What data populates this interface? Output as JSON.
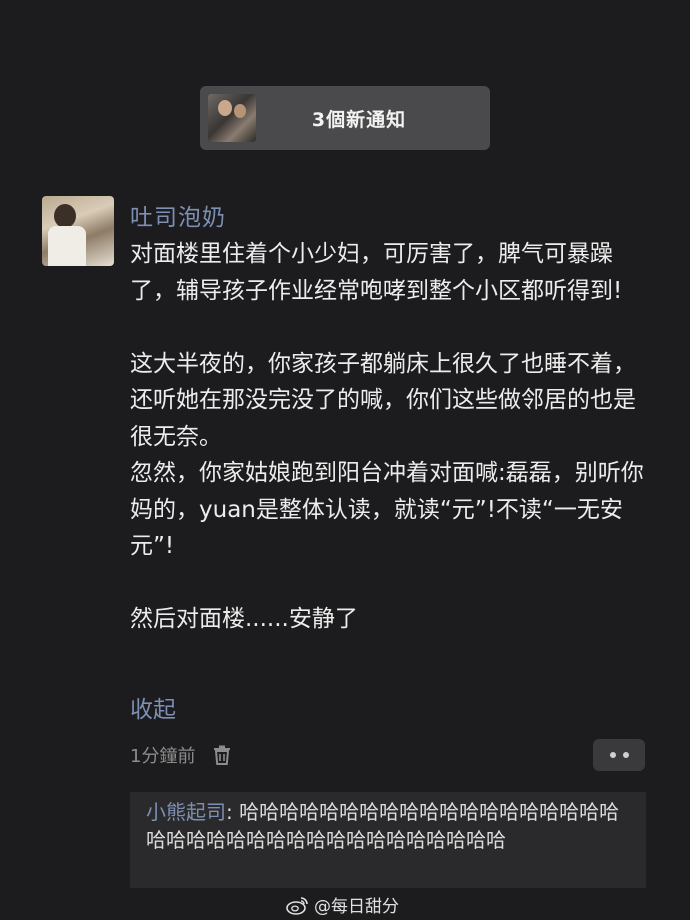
{
  "notification": {
    "text": "3個新通知"
  },
  "post": {
    "username": "吐司泡奶",
    "paragraphs": [
      "对面楼里住着个小少妇，可厉害了，脾气可暴躁了，辅导孩子作业经常咆哮到整个小区都听得到!",
      "",
      "这大半夜的，你家孩子都躺床上很久了也睡不着，还听她在那没完没了的喊，你们这些做邻居的也是很无奈。",
      "忽然，你家姑娘跑到阳台冲着对面喊:磊磊，别听你妈的，yuan是整体认读，就读“元”!不读“一无安元”!",
      "",
      "然后对面楼......安静了"
    ],
    "collapse_label": "收起",
    "time": "1分鐘前"
  },
  "reply": {
    "author": "小熊起司",
    "separator": ": ",
    "text": "哈哈哈哈哈哈哈哈哈哈哈哈哈哈哈哈哈哈哈哈哈哈哈哈哈哈哈哈哈哈哈哈哈哈哈哈哈"
  },
  "watermark": {
    "text": "@每日甜分"
  }
}
